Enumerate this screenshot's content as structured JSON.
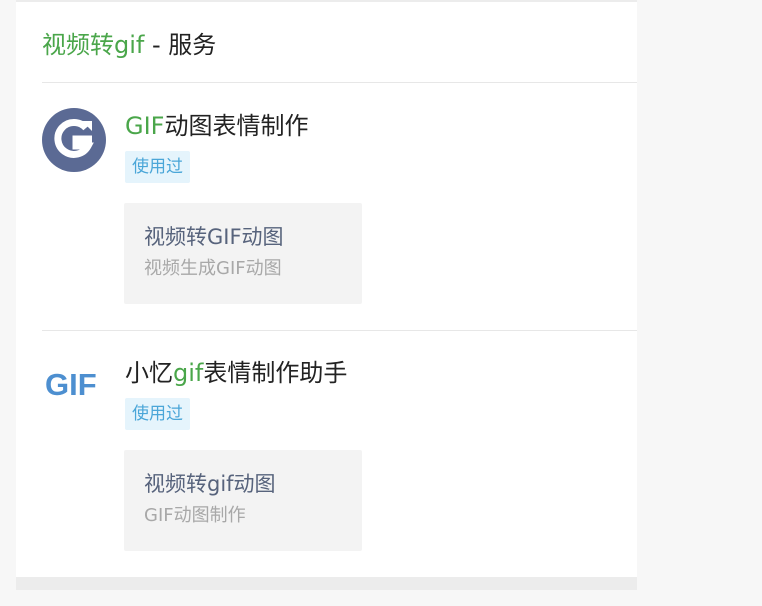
{
  "header": {
    "prefix": "视频转gif",
    "suffix": " - 服务"
  },
  "services": [
    {
      "title_accent": "GIF",
      "title_rest": "动图表情制作",
      "badge": "使用过",
      "card": {
        "title": "视频转GIF动图",
        "subtitle": "视频生成GIF动图"
      }
    },
    {
      "logo_text": "GIF",
      "title_lead": "小忆",
      "title_accent": "gif",
      "title_rest": "表情制作助手",
      "badge": "使用过",
      "card": {
        "title": "视频转gif动图",
        "subtitle": "GIF动图制作"
      }
    }
  ],
  "colors": {
    "accent_green": "#4aa64a",
    "badge_text": "#4aa6d8",
    "badge_bg": "#e5f4fc",
    "logo_blue": "#4d8fd0"
  }
}
